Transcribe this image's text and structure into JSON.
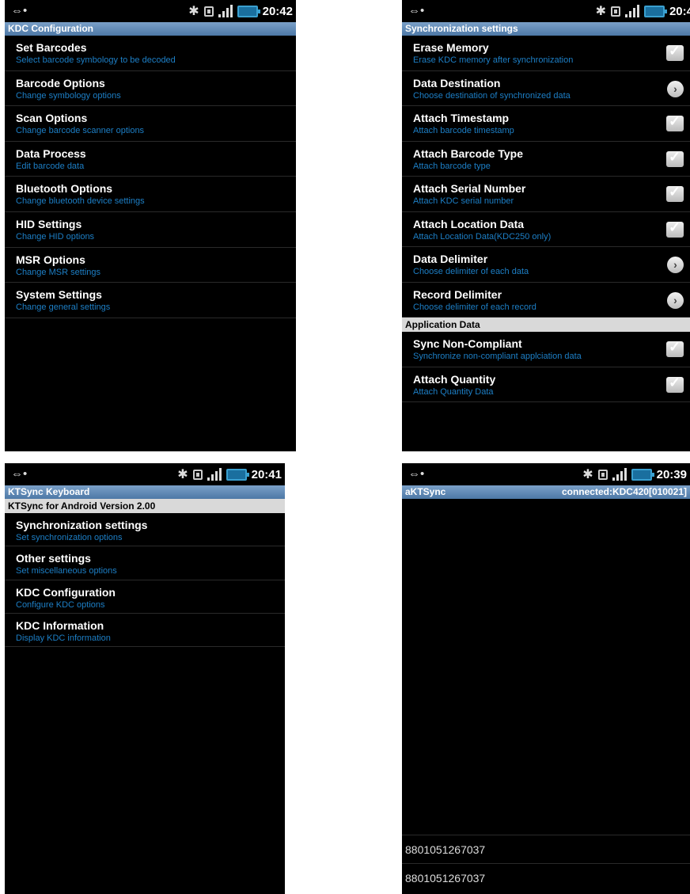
{
  "screens": {
    "kdc_config": {
      "time": "20:42",
      "title": "KDC Configuration",
      "items": [
        {
          "title": "Set Barcodes",
          "sub": "Select barcode symbology to be decoded"
        },
        {
          "title": "Barcode Options",
          "sub": "Change symbology options"
        },
        {
          "title": "Scan Options",
          "sub": "Change barcode scanner options"
        },
        {
          "title": "Data Process",
          "sub": "Edit barcode data"
        },
        {
          "title": "Bluetooth Options",
          "sub": "Change bluetooth device settings"
        },
        {
          "title": "HID Settings",
          "sub": "Change HID options"
        },
        {
          "title": "MSR Options",
          "sub": "Change MSR settings"
        },
        {
          "title": "System Settings",
          "sub": "Change general settings"
        }
      ]
    },
    "sync_settings": {
      "time": "20:4",
      "title": "Synchronization settings",
      "items": [
        {
          "title": "Erase Memory",
          "sub": "Erase KDC memory after synchronization",
          "control": "checkbox"
        },
        {
          "title": "Data Destination",
          "sub": "Choose destination of synchronized data",
          "control": "arrow"
        },
        {
          "title": "Attach Timestamp",
          "sub": "Attach barcode timestamp",
          "control": "checkbox"
        },
        {
          "title": "Attach Barcode Type",
          "sub": "Attach barcode type",
          "control": "checkbox"
        },
        {
          "title": "Attach Serial Number",
          "sub": "Attach KDC serial number",
          "control": "checkbox"
        },
        {
          "title": "Attach Location Data",
          "sub": "Attach Location Data(KDC250 only)",
          "control": "checkbox"
        },
        {
          "title": "Data Delimiter",
          "sub": "Choose delimiter of each data",
          "control": "arrow"
        },
        {
          "title": "Record Delimiter",
          "sub": "Choose delimiter of each record",
          "control": "arrow"
        }
      ],
      "section2": "Application Data",
      "items2": [
        {
          "title": "Sync Non-Compliant",
          "sub": "Synchronize non-compliant applciation data",
          "control": "checkbox"
        },
        {
          "title": "Attach Quantity",
          "sub": "Attach Quantity Data",
          "control": "checkbox"
        }
      ]
    },
    "ktsync_keyboard": {
      "time": "20:41",
      "title": "KTSync Keyboard",
      "version": "KTSync for Android Version 2.00",
      "items": [
        {
          "title": "Synchronization settings",
          "sub": "Set synchronization options"
        },
        {
          "title": "Other settings",
          "sub": "Set miscellaneous options"
        },
        {
          "title": "KDC Configuration",
          "sub": "Configure KDC options"
        },
        {
          "title": "KDC Information",
          "sub": "Display KDC information"
        }
      ]
    },
    "aktsync": {
      "time": "20:39",
      "title": "aKTSync",
      "status": "connected:KDC420[010021]",
      "barcodes": [
        "8801051267037",
        "8801051267037"
      ]
    }
  },
  "icons": {
    "usb": "usb-icon",
    "bluetooth": "bluetooth-icon",
    "sd": "sd-card-icon",
    "signal": "signal-icon",
    "battery": "battery-icon"
  },
  "colors": {
    "title_bar": "#5a86b4",
    "subtitle": "#1d7fc6",
    "section_header": "#d9d9d9"
  }
}
